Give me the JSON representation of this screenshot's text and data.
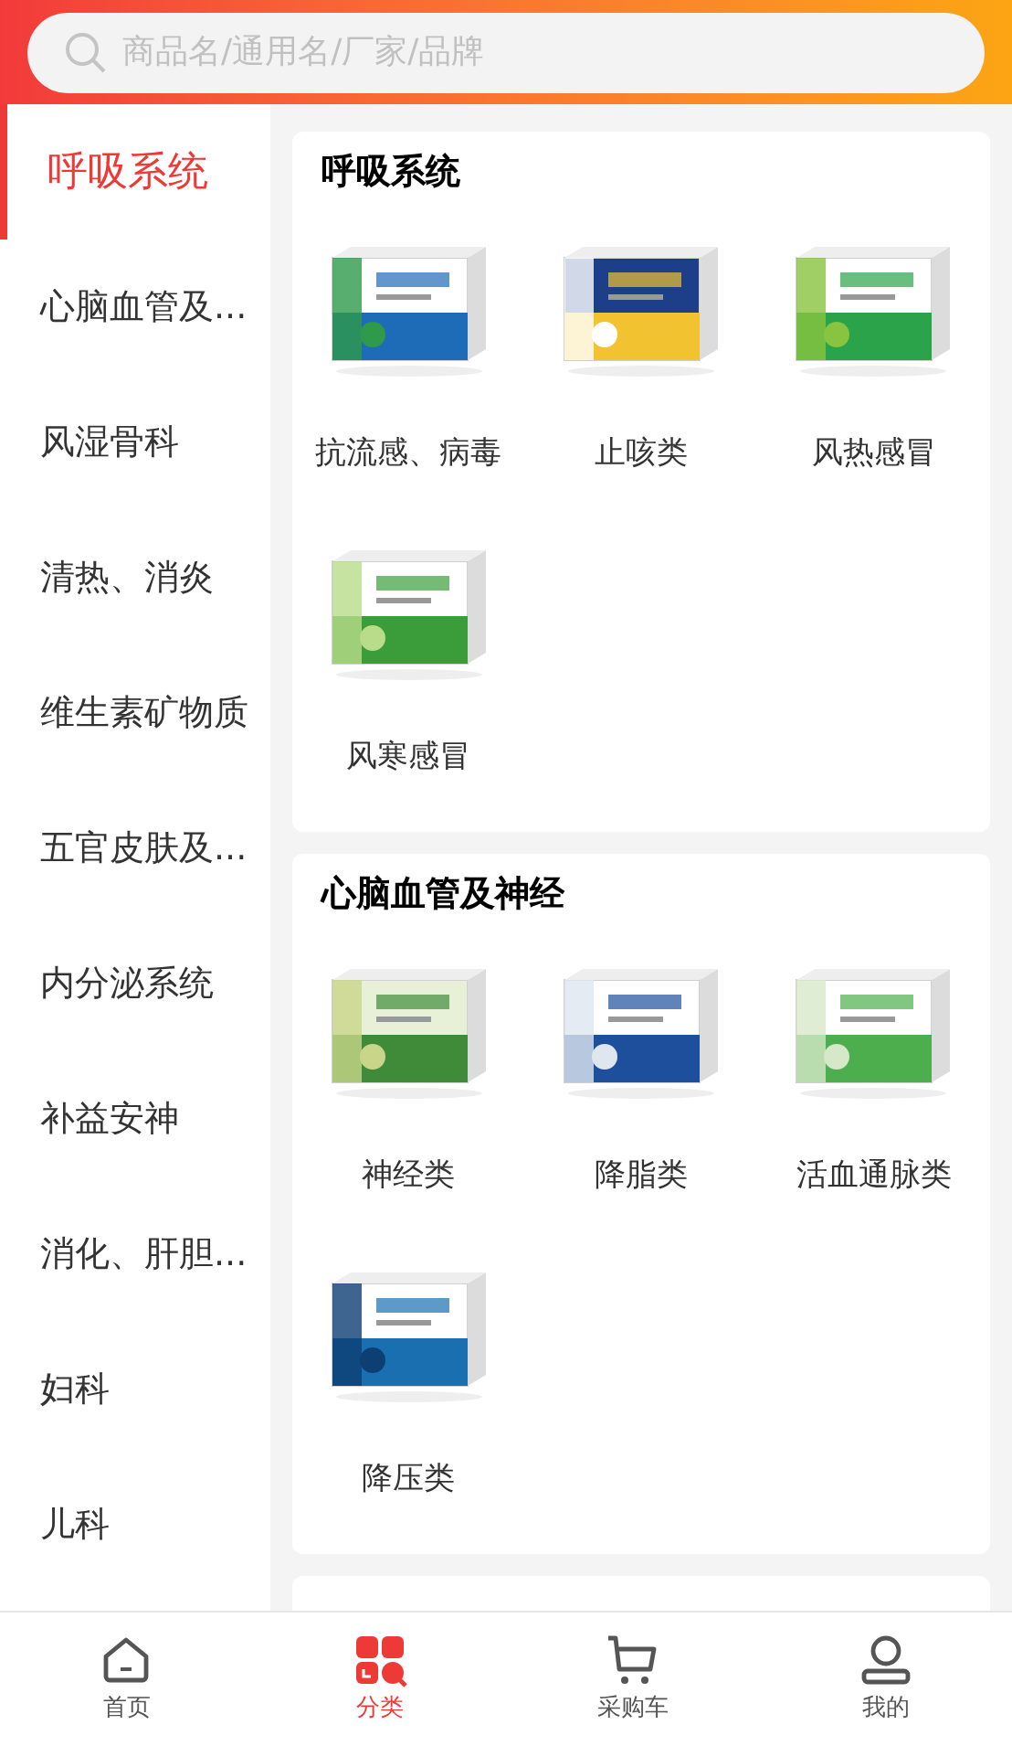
{
  "search": {
    "placeholder": "商品名/通用名/厂家/品牌"
  },
  "sidebar": {
    "items": [
      {
        "label": "呼吸系统",
        "selected": true
      },
      {
        "label": "心脑血管及...",
        "selected": false
      },
      {
        "label": "风湿骨科",
        "selected": false
      },
      {
        "label": "清热、消炎",
        "selected": false
      },
      {
        "label": "维生素矿物质",
        "selected": false
      },
      {
        "label": "五官皮肤及...",
        "selected": false
      },
      {
        "label": "内分泌系统",
        "selected": false
      },
      {
        "label": "补益安神",
        "selected": false
      },
      {
        "label": "消化、肝胆...",
        "selected": false
      },
      {
        "label": "妇科",
        "selected": false
      },
      {
        "label": "儿科",
        "selected": false
      }
    ]
  },
  "sections": [
    {
      "title": "呼吸系统",
      "items": [
        {
          "label": "抗流感、病毒"
        },
        {
          "label": "止咳类"
        },
        {
          "label": "风热感冒"
        },
        {
          "label": "风寒感冒"
        }
      ]
    },
    {
      "title": "心脑血管及神经",
      "items": [
        {
          "label": "神经类"
        },
        {
          "label": "降脂类"
        },
        {
          "label": "活血通脉类"
        },
        {
          "label": "降压类"
        }
      ]
    }
  ],
  "tab_bar": [
    {
      "label": "首页",
      "kind": "home",
      "selected": false
    },
    {
      "label": "分类",
      "kind": "category",
      "selected": true
    },
    {
      "label": "采购车",
      "kind": "cart",
      "selected": false
    },
    {
      "label": "我的",
      "kind": "profile",
      "selected": false
    }
  ]
}
